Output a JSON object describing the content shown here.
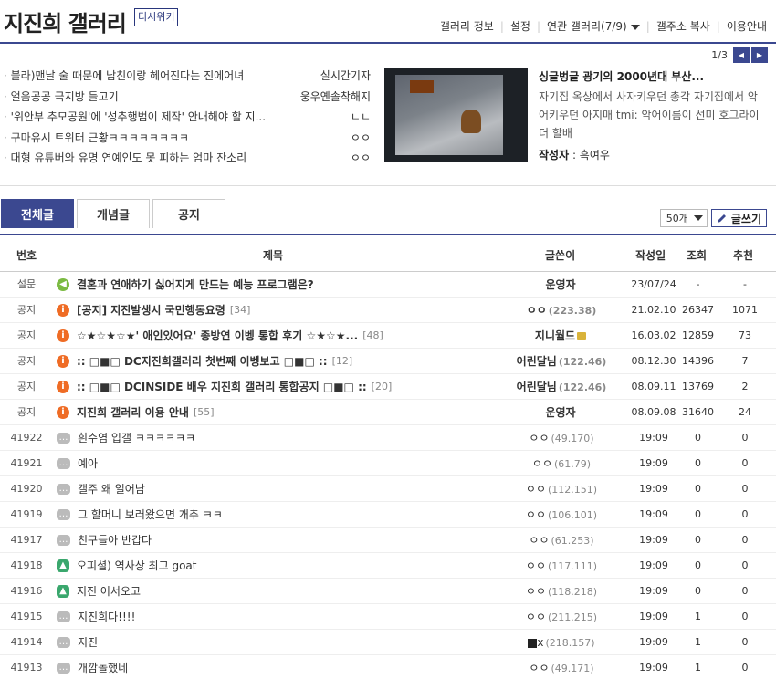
{
  "header": {
    "title": "지진희 갤러리",
    "wiki_label": "디시위키",
    "links": [
      "갤러리 정보",
      "설정",
      "연관 갤러리(7/9)",
      "갤주소 복사",
      "이용안내"
    ]
  },
  "pager": {
    "label": "1/3"
  },
  "hot_list": [
    {
      "title": "블라)맨날 술 때문에 남친이랑 헤어진다는 진에어녀",
      "author": "실시간기자"
    },
    {
      "title": "얼음공공 극지방 들고기",
      "author": "웅우옌솔착해지"
    },
    {
      "title": "'위안부 추모공원'에 '성추행범이 제작' 안내해야 할 지...",
      "author": "ㄴㄴ"
    },
    {
      "title": "구마유시 트위터 근황ㅋㅋㅋㅋㅋㅋㅋㅋ",
      "author": "ㅇㅇ"
    },
    {
      "title": "대형 유튜버와 유명 연예인도 못 피하는 엄마 잔소리",
      "author": "ㅇㅇ"
    }
  ],
  "featured": {
    "title": "싱글벙글 광기의 2000년대 부산...",
    "desc": "자기집 옥상에서 사자키우던 총각 자기집에서 악어키우던 아지매 tmi: 악어이름이 선미 호그라이더 할배",
    "author_label": "작성자",
    "author": "흑여우"
  },
  "tabs": [
    "전체글",
    "개념글",
    "공지"
  ],
  "controls": {
    "per_page": "50개",
    "write": "글쓰기"
  },
  "table": {
    "headers": [
      "번호",
      "제목",
      "글쓴이",
      "작성일",
      "조회",
      "추천"
    ],
    "rows": [
      {
        "num": "설문",
        "icon": "speaker",
        "title": "결혼과 연애하기 싫어지게 만드는 예능 프로그램은?",
        "count": "",
        "writer": "운영자",
        "ip": "",
        "date": "23/07/24",
        "views": "-",
        "rec": "-",
        "notice": true
      },
      {
        "num": "공지",
        "icon": "info",
        "title": "[공지] 지진발생시 국민행동요령",
        "count": "[34]",
        "writer": "ㅇㅇ",
        "ip": "(223.38)",
        "date": "21.02.10",
        "views": "26347",
        "rec": "1071",
        "notice": true
      },
      {
        "num": "공지",
        "icon": "info",
        "title": "☆★☆★☆★' 애인있어요' 종방연 이벵 통합 후기 ☆★☆★...",
        "count": "[48]",
        "writer": "지니월드",
        "ip": "",
        "date": "16.03.02",
        "views": "12859",
        "rec": "73",
        "notice": true,
        "lock": true
      },
      {
        "num": "공지",
        "icon": "info",
        "title": ":: □■□ DC지진희갤러리 첫번째 이벵보고 □■□ ::",
        "count": "[12]",
        "writer": "어린달님",
        "ip": "(122.46)",
        "date": "08.12.30",
        "views": "14396",
        "rec": "7",
        "notice": true
      },
      {
        "num": "공지",
        "icon": "info",
        "title": ":: □■□ DCINSIDE 배우 지진희 갤러리 통합공지 □■□ ::",
        "count": "[20]",
        "writer": "어린달님",
        "ip": "(122.46)",
        "date": "08.09.11",
        "views": "13769",
        "rec": "2",
        "notice": true
      },
      {
        "num": "공지",
        "icon": "info",
        "title": "지진희 갤러리 이용 안내",
        "count": "[55]",
        "writer": "운영자",
        "ip": "",
        "date": "08.09.08",
        "views": "31640",
        "rec": "24",
        "notice": true
      },
      {
        "num": "41922",
        "icon": "comment",
        "title": "흰수염 입갤 ㅋㅋㅋㅋㅋㅋ",
        "count": "",
        "writer": "ㅇㅇ",
        "ip": "(49.170)",
        "date": "19:09",
        "views": "0",
        "rec": "0"
      },
      {
        "num": "41921",
        "icon": "comment",
        "title": "예아",
        "count": "",
        "writer": "ㅇㅇ",
        "ip": "(61.79)",
        "date": "19:09",
        "views": "0",
        "rec": "0"
      },
      {
        "num": "41920",
        "icon": "comment",
        "title": "갤주 왜 일어남",
        "count": "",
        "writer": "ㅇㅇ",
        "ip": "(112.151)",
        "date": "19:09",
        "views": "0",
        "rec": "0"
      },
      {
        "num": "41919",
        "icon": "comment",
        "title": "그 할머니 보러왔으면 개추 ㅋㅋ",
        "count": "",
        "writer": "ㅇㅇ",
        "ip": "(106.101)",
        "date": "19:09",
        "views": "0",
        "rec": "0"
      },
      {
        "num": "41917",
        "icon": "comment",
        "title": "친구들아 반갑다",
        "count": "",
        "writer": "ㅇㅇ",
        "ip": "(61.253)",
        "date": "19:09",
        "views": "0",
        "rec": "0"
      },
      {
        "num": "41918",
        "icon": "image",
        "title": "오피셜) 역사상 최고 goat",
        "count": "",
        "writer": "ㅇㅇ",
        "ip": "(117.111)",
        "date": "19:09",
        "views": "0",
        "rec": "0"
      },
      {
        "num": "41916",
        "icon": "image",
        "title": "지진 어서오고",
        "count": "",
        "writer": "ㅇㅇ",
        "ip": "(118.218)",
        "date": "19:09",
        "views": "0",
        "rec": "0"
      },
      {
        "num": "41915",
        "icon": "comment",
        "title": "지진희다!!!!",
        "count": "",
        "writer": "ㅇㅇ",
        "ip": "(211.215)",
        "date": "19:09",
        "views": "1",
        "rec": "0"
      },
      {
        "num": "41914",
        "icon": "comment",
        "title": "지진",
        "count": "",
        "writer": "x",
        "ip": "(218.157)",
        "date": "19:09",
        "views": "1",
        "rec": "0",
        "block": true
      },
      {
        "num": "41913",
        "icon": "comment",
        "title": "개깜놀했네",
        "count": "",
        "writer": "ㅇㅇ",
        "ip": "(49.171)",
        "date": "19:09",
        "views": "1",
        "rec": "0"
      }
    ]
  }
}
